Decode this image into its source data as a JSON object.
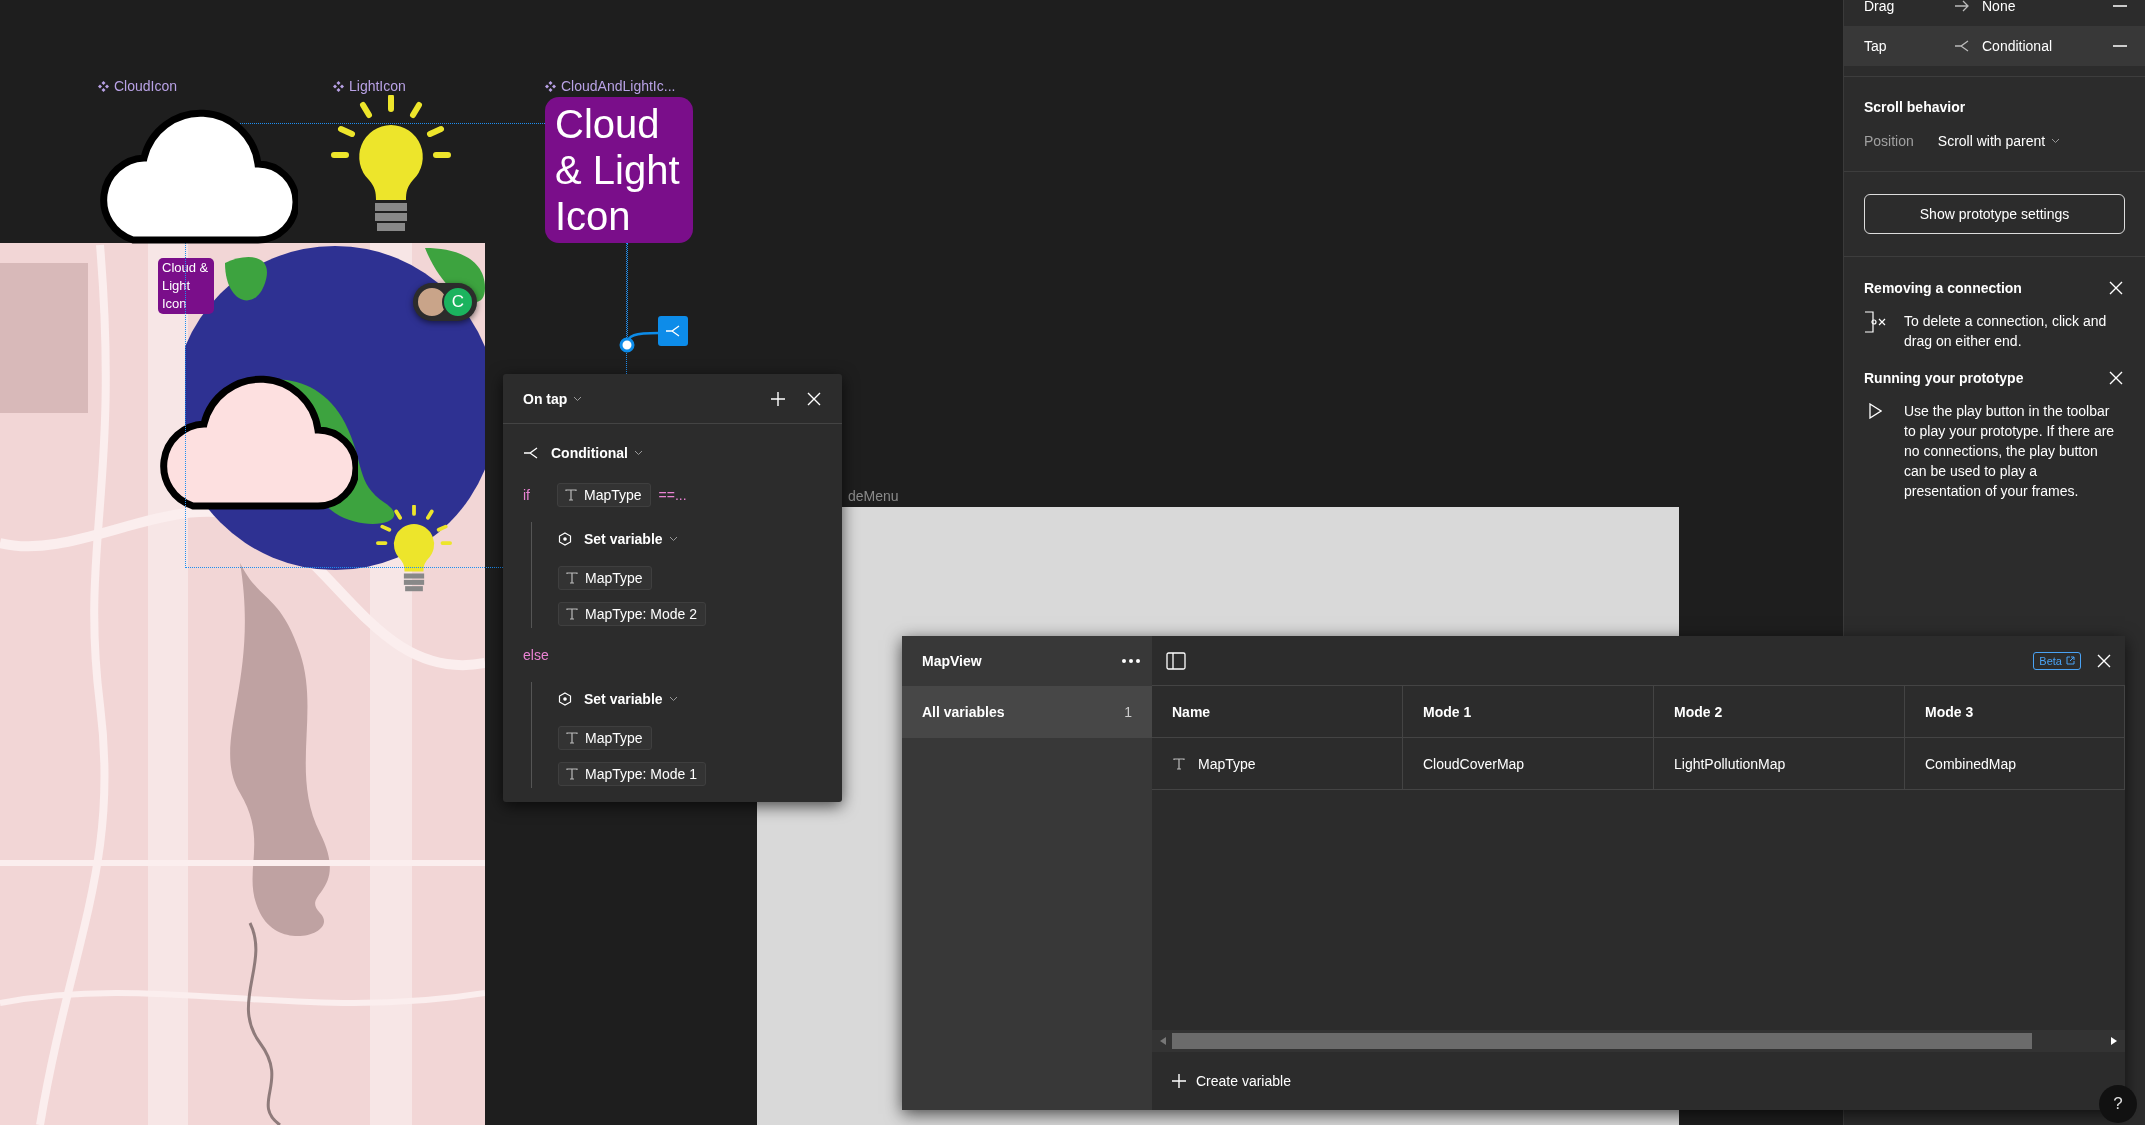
{
  "canvas": {
    "components": [
      {
        "label": "CloudIcon",
        "kind": "cloud"
      },
      {
        "label": "LightIcon",
        "kind": "bulb"
      },
      {
        "label": "CloudAndLightIc...",
        "kind": "card",
        "text": "Cloud & Light Icon"
      }
    ],
    "small_label": "Cloud & Light Icon",
    "avatar_initial": "C",
    "frame_label": "deMenu"
  },
  "popover": {
    "trigger": "On tap",
    "action": "Conditional",
    "branches": [
      {
        "keyword": "if",
        "condition_chip": "MapType",
        "operator": "==...",
        "actions": [
          {
            "label": "Set variable",
            "chips": [
              "MapType",
              "MapType: Mode 2"
            ]
          }
        ]
      },
      {
        "keyword": "else",
        "actions": [
          {
            "label": "Set variable",
            "chips": [
              "MapType",
              "MapType: Mode 1"
            ]
          }
        ]
      }
    ]
  },
  "right_panel": {
    "interactions": [
      {
        "trigger": "Drag",
        "kind": "arrow",
        "action": "None",
        "selected": false
      },
      {
        "trigger": "Tap",
        "kind": "branch",
        "action": "Conditional",
        "selected": true
      }
    ],
    "scroll_behavior": {
      "title": "Scroll behavior",
      "label": "Position",
      "value": "Scroll with parent"
    },
    "button": "Show prototype settings",
    "tips": [
      {
        "kind": "connection",
        "title": "Removing a connection",
        "text": "To delete a connection, click and drag on either end."
      },
      {
        "kind": "play",
        "title": "Running your prototype",
        "text": "Use the play button in the toolbar to play your prototype. If there are no connections, the play button can be used to play a presentation of your frames."
      }
    ]
  },
  "variables": {
    "collection": "MapView",
    "groups": [
      {
        "label": "All variables",
        "count": "1",
        "selected": true
      }
    ],
    "beta": "Beta",
    "columns": [
      "Name",
      "Mode 1",
      "Mode 2",
      "Mode 3"
    ],
    "rows": [
      {
        "name": "MapType",
        "values": [
          "CloudCoverMap",
          "LightPollutionMap",
          "CombinedMap"
        ]
      }
    ],
    "create": "Create variable"
  },
  "help": "?"
}
